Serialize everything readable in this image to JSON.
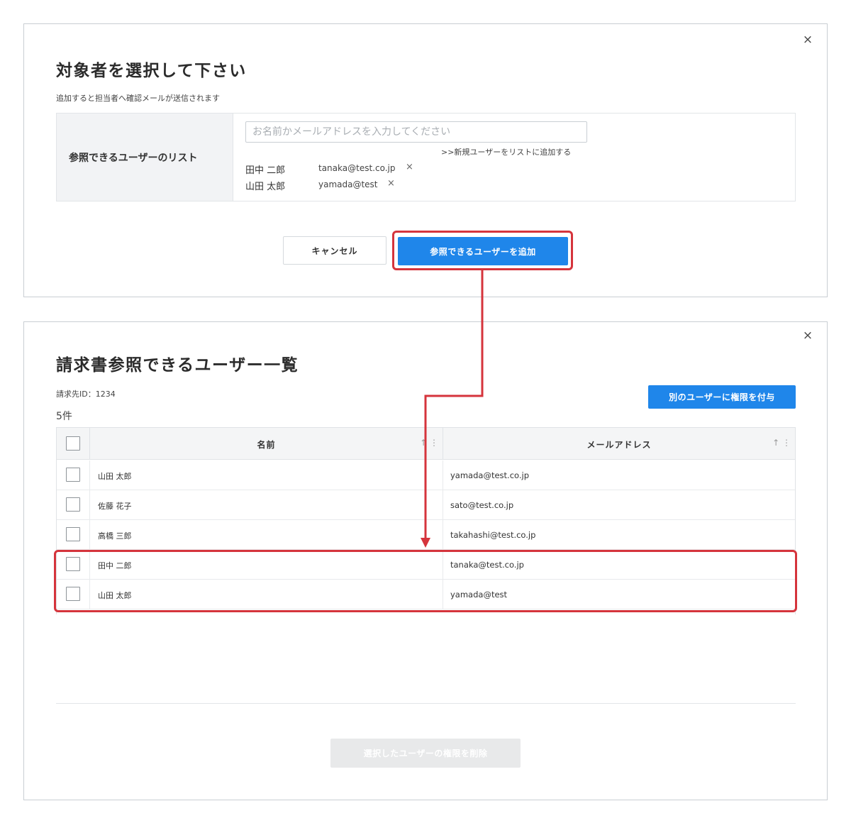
{
  "dialog_select": {
    "title": "対象者を選択して下さい",
    "subtitle": "追加すると担当者へ確認メールが送信されます",
    "form_label": "参照できるユーザーのリスト",
    "search_placeholder": "お名前かメールアドレスを入力してください",
    "add_new_link": ">>新規ユーザーをリストに追加する",
    "selected_users": [
      {
        "name": "田中 二郎",
        "email": "tanaka@test.co.jp",
        "remove": "×"
      },
      {
        "name": "山田 太郎",
        "email": "yamada@test",
        "remove": "×"
      }
    ],
    "cancel_label": "キャンセル",
    "submit_label": "参照できるユーザーを追加",
    "close": "×"
  },
  "dialog_list": {
    "title": "請求書参照できるユーザー一覧",
    "billing_id": "請求先ID：1234",
    "count": "5件",
    "grant_label": "別のユーザーに権限を付与",
    "columns": {
      "name": "名前",
      "email": "メールアドレス",
      "sort": "↑ ⋮"
    },
    "rows": [
      {
        "name": "山田 太郎",
        "email": "yamada@test.co.jp"
      },
      {
        "name": "佐藤 花子",
        "email": "sato@test.co.jp"
      },
      {
        "name": "高橋 三郎",
        "email": "takahashi@test.co.jp"
      },
      {
        "name": "田中 二郎",
        "email": "tanaka@test.co.jp"
      },
      {
        "name": "山田 太郎",
        "email": "yamada@test"
      }
    ],
    "delete_label": "選択したユーザーの権限を削除",
    "close": "×"
  },
  "colors": {
    "primary": "#1f86ea",
    "highlight": "#d5343c",
    "disabled": "#e8e9ea"
  }
}
